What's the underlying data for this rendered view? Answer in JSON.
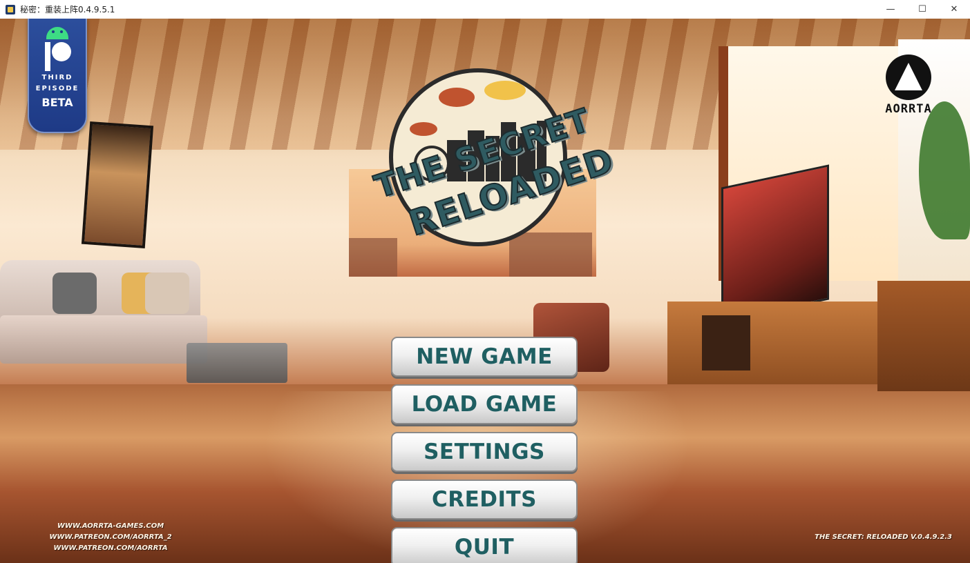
{
  "window": {
    "title": "秘密：重装上阵0.4.9.5.1",
    "controls": {
      "minimize": "—",
      "maximize": "☐",
      "close": "✕"
    }
  },
  "badge": {
    "line1": "THIRD",
    "line2": "EPISODE",
    "line3": "BETA",
    "icons": [
      "android-icon",
      "patreon-icon"
    ]
  },
  "logo": {
    "line1": "THE SECRET",
    "line2": "RELOADED"
  },
  "studio": {
    "name": "AORRTA"
  },
  "menu": {
    "items": [
      {
        "label": "NEW GAME"
      },
      {
        "label": "LOAD GAME"
      },
      {
        "label": "SETTINGS"
      },
      {
        "label": "CREDITS"
      },
      {
        "label": "QUIT"
      }
    ]
  },
  "links": [
    "WWW.AORRTA-GAMES.COM",
    "WWW.PATREON.COM/AORRTA_2",
    "WWW.PATREON.COM/AORRTA"
  ],
  "version": "THE SECRET: RELOADED V.0.4.9.2.3",
  "colors": {
    "button_text": "#1f5f62",
    "badge_blue": "#1e3a86",
    "android_green": "#3ddc84"
  }
}
